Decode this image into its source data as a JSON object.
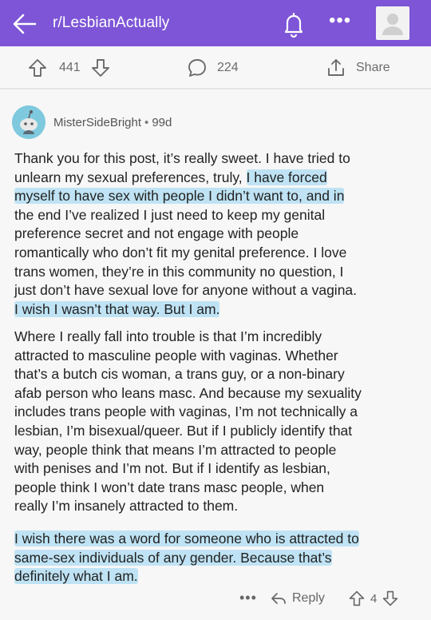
{
  "header": {
    "subreddit": "r/LesbianActually",
    "more_label": "•••"
  },
  "actions": {
    "upvotes": "441",
    "comments": "224",
    "share_label": "Share"
  },
  "comment": {
    "author": "MisterSideBright",
    "separator": "•",
    "age": "99d",
    "paragraphs": [
      [
        {
          "text": "Thank you for this post, it’s really sweet. I have tried to"
        },
        {
          "text": "unlearn my sexual preferences, truly, ",
          "hl": "I have forced"
        },
        {
          "hl": "myself to have sex with people I didn’t want to, and in"
        },
        {
          "text": "the end I’ve realized I just need to keep my genital"
        },
        {
          "text": "preference secret and not engage with people"
        },
        {
          "text": "romantically who don’t fit my genital preference. I love"
        },
        {
          "text": "trans women, they’re in this community no question, I"
        },
        {
          "text": "just don’t have sexual love for anyone without a vagina."
        },
        {
          "hl": "I wish I wasn’t that way. But I am."
        }
      ],
      [
        {
          "text": "Where I really fall into trouble is that I’m incredibly"
        },
        {
          "text": "attracted to masculine people with vaginas. Whether"
        },
        {
          "text": "that’s a butch cis woman, a trans guy, or a non-binary"
        },
        {
          "text": "afab person who leans masc. And because my sexuality"
        },
        {
          "text": "includes trans people with vaginas, I’m not technically a"
        },
        {
          "text": "lesbian, I’m bisexual/queer. But if I publicly identify that"
        },
        {
          "text": "way, people think that means I’m attracted to people"
        },
        {
          "text": "with penises and I’m not. But if I identify as lesbian,"
        },
        {
          "text": "people think I won’t date trans masc people, when"
        },
        {
          "text": "really I’m insanely attracted to them."
        }
      ],
      [
        {
          "hl": "I wish there was a word for someone who is attracted to"
        },
        {
          "hl": "same-sex individuals of any gender. Because that’s"
        },
        {
          "hl": "definitely what I am."
        }
      ]
    ]
  },
  "footer": {
    "more_label": "•••",
    "reply_label": "Reply",
    "score": "4"
  },
  "colors": {
    "header_bg": "#7d55d6",
    "highlight": "#bfe3f4",
    "avatar_bg": "#7ec9de"
  },
  "icons": [
    "back-arrow-icon",
    "bell-icon",
    "more-icon",
    "avatar-placeholder-icon",
    "upvote-icon",
    "downvote-icon",
    "comment-icon",
    "share-icon",
    "snoo-avatar-icon",
    "reply-icon"
  ]
}
